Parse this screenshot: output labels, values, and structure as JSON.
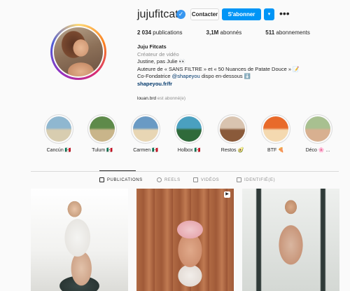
{
  "profile": {
    "username": "jujufitcats",
    "verified_icon": "verified-badge-icon",
    "contact_label": "Contacter",
    "follow_label": "S'abonner",
    "dropdown_icon": "chevron-down-icon",
    "more_icon": "more-options-icon",
    "stats": {
      "posts": "2 034",
      "posts_label": "publications",
      "followers": "3,1M",
      "followers_label": "abonnés",
      "following": "511",
      "following_label": "abonnements"
    },
    "bio": {
      "name": "Juju Fitcats",
      "category": "Créateur de vidéo",
      "line1": "Justine, pas Julie 👀",
      "line2": "Auteure de « SANS FILTRE » et « 50 Nuances de Patate Douce » 📝",
      "line3_pre": "Co-Fondatrice ",
      "line3_tag": "@shapeyou",
      "line3_post": " dispo en-dessous ⬇️",
      "link": "shapeyou.fr/fr"
    },
    "followed_by_user": "louan.brd",
    "followed_by_text": " est abonné(e)"
  },
  "highlights": [
    {
      "label": "Cancún 🇲🇽",
      "colors": [
        "#8fb7d0",
        "#d8cdb0"
      ]
    },
    {
      "label": "Tulum 🇲🇽",
      "colors": [
        "#5e8a4a",
        "#c9b58a"
      ]
    },
    {
      "label": "Carmen 🇲🇽",
      "colors": [
        "#6a9ac4",
        "#e8d6b4"
      ]
    },
    {
      "label": "Holbox 🇲🇽",
      "colors": [
        "#4aa0c0",
        "#2f6a3a"
      ]
    },
    {
      "label": "Restos 🥑",
      "colors": [
        "#d9c4b0",
        "#8a5a3a"
      ]
    },
    {
      "label": "BTF 🍕",
      "colors": [
        "#e86a2a",
        "#f4d9b0"
      ]
    },
    {
      "label": "Déco 🌸 ...",
      "colors": [
        "#a8c090",
        "#d8b090"
      ]
    }
  ],
  "tabs": {
    "publications": "PUBLICATIONS",
    "reels": "REELS",
    "videos": "VIDÉOS",
    "tagged": "IDENTIFIÉ(E)"
  },
  "posts": [
    {
      "type": "photo"
    },
    {
      "type": "reel",
      "badge_icon": "reel-icon"
    },
    {
      "type": "photo"
    }
  ]
}
